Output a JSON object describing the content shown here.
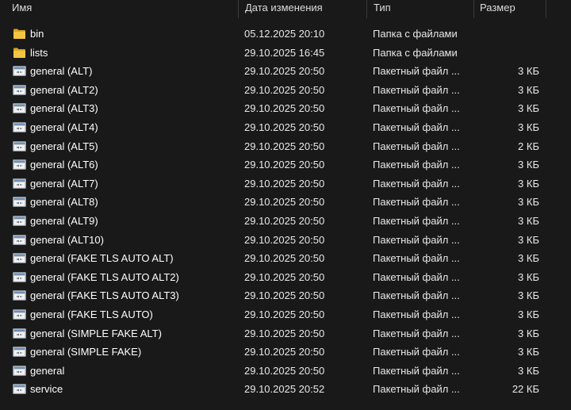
{
  "columns": {
    "name": "Имя",
    "modified": "Дата изменения",
    "type": "Тип",
    "size": "Размер"
  },
  "rows": [
    {
      "name": "bin",
      "modified": "05.12.2025 20:10",
      "type": "Папка с файлами",
      "size": "",
      "icon": "folder-icon"
    },
    {
      "name": "lists",
      "modified": "29.10.2025 16:45",
      "type": "Папка с файлами",
      "size": "",
      "icon": "folder-icon"
    },
    {
      "name": "general (ALT)",
      "modified": "29.10.2025 20:50",
      "type": "Пакетный файл ...",
      "size": "3 КБ",
      "icon": "batch-file-icon"
    },
    {
      "name": "general (ALT2)",
      "modified": "29.10.2025 20:50",
      "type": "Пакетный файл ...",
      "size": "3 КБ",
      "icon": "batch-file-icon"
    },
    {
      "name": "general (ALT3)",
      "modified": "29.10.2025 20:50",
      "type": "Пакетный файл ...",
      "size": "3 КБ",
      "icon": "batch-file-icon"
    },
    {
      "name": "general (ALT4)",
      "modified": "29.10.2025 20:50",
      "type": "Пакетный файл ...",
      "size": "3 КБ",
      "icon": "batch-file-icon"
    },
    {
      "name": "general (ALT5)",
      "modified": "29.10.2025 20:50",
      "type": "Пакетный файл ...",
      "size": "2 КБ",
      "icon": "batch-file-icon"
    },
    {
      "name": "general (ALT6)",
      "modified": "29.10.2025 20:50",
      "type": "Пакетный файл ...",
      "size": "3 КБ",
      "icon": "batch-file-icon"
    },
    {
      "name": "general (ALT7)",
      "modified": "29.10.2025 20:50",
      "type": "Пакетный файл ...",
      "size": "3 КБ",
      "icon": "batch-file-icon"
    },
    {
      "name": "general (ALT8)",
      "modified": "29.10.2025 20:50",
      "type": "Пакетный файл ...",
      "size": "3 КБ",
      "icon": "batch-file-icon"
    },
    {
      "name": "general (ALT9)",
      "modified": "29.10.2025 20:50",
      "type": "Пакетный файл ...",
      "size": "3 КБ",
      "icon": "batch-file-icon"
    },
    {
      "name": "general (ALT10)",
      "modified": "29.10.2025 20:50",
      "type": "Пакетный файл ...",
      "size": "3 КБ",
      "icon": "batch-file-icon"
    },
    {
      "name": "general (FAKE TLS AUTO ALT)",
      "modified": "29.10.2025 20:50",
      "type": "Пакетный файл ...",
      "size": "3 КБ",
      "icon": "batch-file-icon"
    },
    {
      "name": "general (FAKE TLS AUTO ALT2)",
      "modified": "29.10.2025 20:50",
      "type": "Пакетный файл ...",
      "size": "3 КБ",
      "icon": "batch-file-icon"
    },
    {
      "name": "general (FAKE TLS AUTO ALT3)",
      "modified": "29.10.2025 20:50",
      "type": "Пакетный файл ...",
      "size": "3 КБ",
      "icon": "batch-file-icon"
    },
    {
      "name": "general (FAKE TLS AUTO)",
      "modified": "29.10.2025 20:50",
      "type": "Пакетный файл ...",
      "size": "3 КБ",
      "icon": "batch-file-icon"
    },
    {
      "name": "general (SIMPLE FAKE ALT)",
      "modified": "29.10.2025 20:50",
      "type": "Пакетный файл ...",
      "size": "3 КБ",
      "icon": "batch-file-icon"
    },
    {
      "name": "general (SIMPLE FAKE)",
      "modified": "29.10.2025 20:50",
      "type": "Пакетный файл ...",
      "size": "3 КБ",
      "icon": "batch-file-icon"
    },
    {
      "name": "general",
      "modified": "29.10.2025 20:50",
      "type": "Пакетный файл ...",
      "size": "3 КБ",
      "icon": "batch-file-icon"
    },
    {
      "name": "service",
      "modified": "29.10.2025 20:52",
      "type": "Пакетный файл ...",
      "size": "22 КБ",
      "icon": "batch-file-icon"
    }
  ],
  "colors": {
    "background": "#191919",
    "folder": "#f4c542",
    "folder_dark": "#d9a520",
    "batch_frame": "#c9ccd1",
    "batch_title": "#6f8fb5"
  }
}
